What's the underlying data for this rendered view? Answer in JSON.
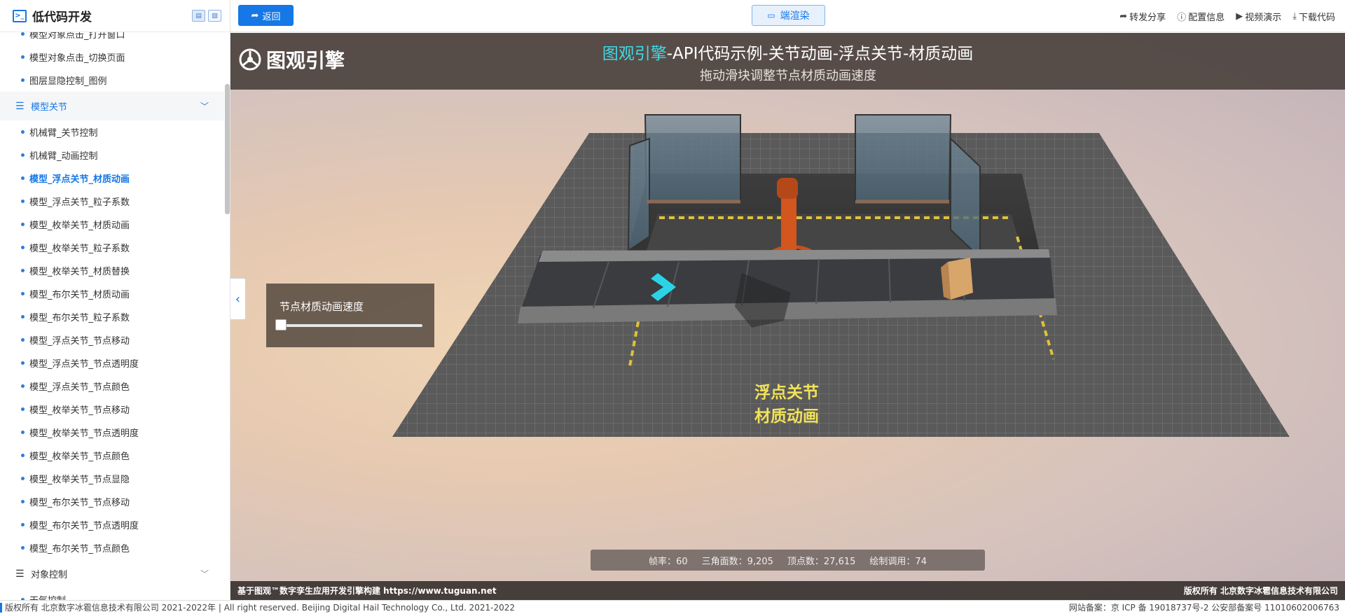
{
  "sidebar": {
    "title": "低代码开发",
    "items_top": [
      "模型对象点击_打开窗口",
      "模型对象点击_切换页面",
      "图层显隐控制_图例"
    ],
    "group_joint": {
      "label": "模型关节"
    },
    "items_joint": [
      "机械臂_关节控制",
      "机械臂_动画控制",
      "模型_浮点关节_材质动画",
      "模型_浮点关节_粒子系数",
      "模型_枚举关节_材质动画",
      "模型_枚举关节_粒子系数",
      "模型_枚举关节_材质替换",
      "模型_布尔关节_材质动画",
      "模型_布尔关节_粒子系数",
      "模型_浮点关节_节点移动",
      "模型_浮点关节_节点透明度",
      "模型_浮点关节_节点颜色",
      "模型_枚举关节_节点移动",
      "模型_枚举关节_节点透明度",
      "模型_枚举关节_节点颜色",
      "模型_枚举关节_节点显隐",
      "模型_布尔关节_节点移动",
      "模型_布尔关节_节点透明度",
      "模型_布尔关节_节点颜色"
    ],
    "active_index": 2,
    "group_object": {
      "label": "对象控制"
    },
    "items_object": [
      "天气控制"
    ]
  },
  "topbar": {
    "back_label": "返回",
    "render_label": "端渲染",
    "actions": [
      {
        "icon": "share-icon",
        "label": "转发分享"
      },
      {
        "icon": "info-icon",
        "label": "配置信息"
      },
      {
        "icon": "play-icon",
        "label": "视频演示"
      },
      {
        "icon": "download-icon",
        "label": "下载代码"
      }
    ]
  },
  "viewport": {
    "brand": "图观引擎",
    "title_accent": "图观引擎",
    "title_rest": "-API代码示例-关节动画-浮点关节-材质动画",
    "subtitle": "拖动滑块调整节点材质动画速度",
    "panel": {
      "label": "节点材质动画速度",
      "value": 0
    },
    "scene_label_line1": "浮点关节",
    "scene_label_line2": "材质动画",
    "stats": [
      {
        "label": "帧率",
        "value": "60"
      },
      {
        "label": "三角面数",
        "value": "9,205"
      },
      {
        "label": "顶点数",
        "value": "27,615"
      },
      {
        "label": "绘制调用",
        "value": "74"
      }
    ],
    "footer_left": "基于图观™数字孪生应用开发引擎构建 https://www.tuguan.net",
    "footer_right": "版权所有 北京数字冰雹信息技术有限公司"
  },
  "bottombar": {
    "copyright": "版权所有 北京数字冰雹信息技术有限公司 2021-2022年 | All right reserved. Beijing Digital Hail Technology Co., Ltd. 2021-2022",
    "icp": "网站备案：京 ICP 备 19018737号-2 公安部备案号 11010602006763"
  },
  "colors": {
    "primary": "#1677e6",
    "title_accent": "#3fd9e6",
    "scene_label": "#f1e25a",
    "robot": "#d2561e"
  }
}
